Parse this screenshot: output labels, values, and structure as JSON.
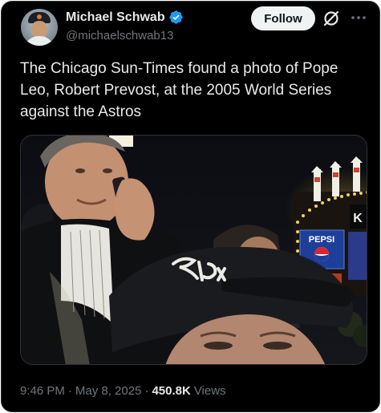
{
  "author": {
    "display_name": "Michael Schwab",
    "handle": "@michaelschwab13",
    "verified": true
  },
  "header": {
    "follow_label": "Follow"
  },
  "tweet": {
    "text": "The Chicago Sun-Times found a photo of Pope Leo, Robert Prevost, at the 2005 World Series against the Astros",
    "time": "9:46 PM",
    "separator": "·",
    "date": "May 8, 2025",
    "views_count": "450.8K",
    "views_label": "Views"
  },
  "media": {
    "sign_text": "PEPSI"
  },
  "colors": {
    "background": "#000000",
    "text": "#e7e9ea",
    "secondary_text": "#71767b",
    "verified": "#1d9bf0",
    "follow_button": "#eff3f4"
  },
  "icons": {
    "verified": "verified-badge-icon",
    "grok": "grok-icon",
    "more": "more-options-icon"
  }
}
